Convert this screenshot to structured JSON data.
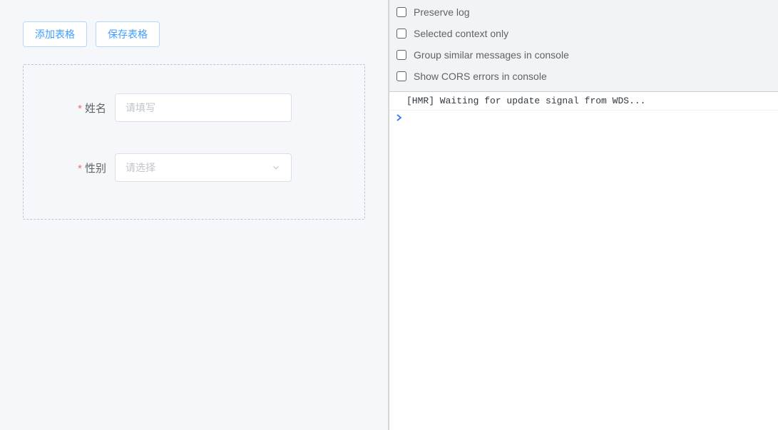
{
  "buttons": {
    "add_table": "添加表格",
    "save_table": "保存表格"
  },
  "form": {
    "name": {
      "label": "姓名",
      "placeholder": "请填写",
      "required_mark": "*"
    },
    "gender": {
      "label": "性别",
      "placeholder": "请选择",
      "required_mark": "*"
    }
  },
  "devtools": {
    "options": {
      "preserve_log": "Preserve log",
      "selected_context_only": "Selected context only",
      "group_similar": "Group similar messages in console",
      "show_cors": "Show CORS errors in console"
    },
    "console_log": "[HMR] Waiting for update signal from WDS...",
    "prompt": ">"
  }
}
